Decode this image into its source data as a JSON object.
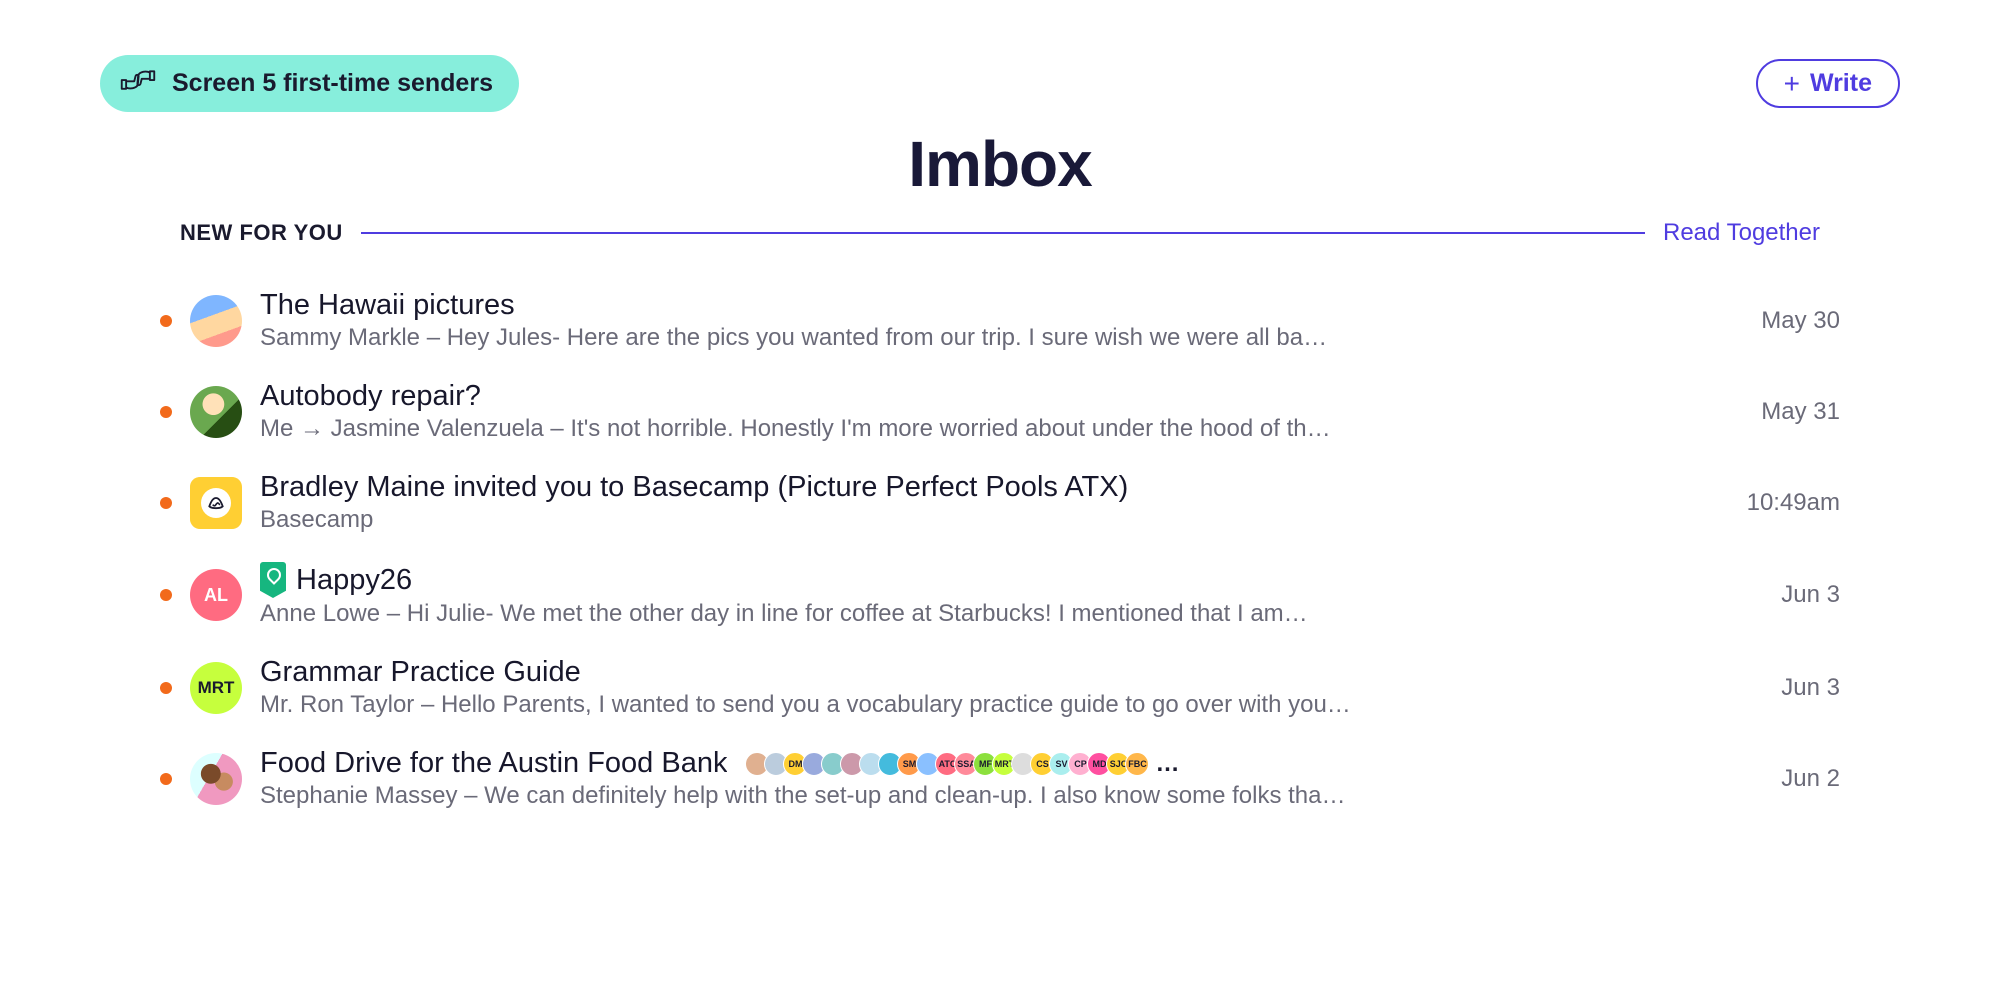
{
  "header": {
    "screener_label": "Screen 5 first-time senders",
    "write_label": "Write"
  },
  "page_title": "Imbox",
  "section": {
    "label": "NEW FOR YOU",
    "read_together": "Read Together"
  },
  "emails": [
    {
      "subject": "The Hawaii pictures",
      "preview": "Sammy Markle – Hey Jules- Here are the pics you wanted from our trip. I sure wish we were all ba…",
      "date": "May 30",
      "avatar_type": "photo1"
    },
    {
      "subject": "Autobody repair?",
      "preview": "Me → Jasmine Valenzuela – It's not horrible. Honestly I'm more worried about under the hood of th…",
      "date": "May 31",
      "avatar_type": "photo2"
    },
    {
      "subject": "Bradley Maine invited you to Basecamp (Picture Perfect Pools ATX)",
      "preview": "Basecamp",
      "date": "10:49am",
      "avatar_type": "basecamp"
    },
    {
      "subject": "Happy26",
      "preview": "Anne Lowe – Hi Julie- We met the other day in line for coffee at Starbucks! I mentioned that I am…",
      "date": "Jun 3",
      "avatar_type": "initials",
      "avatar_initials": "AL",
      "has_clip": true
    },
    {
      "subject": "Grammar Practice Guide",
      "preview": "Mr. Ron Taylor – Hello Parents, I wanted to send you a vocabulary practice guide to go over with you…",
      "date": "Jun 3",
      "avatar_type": "initials",
      "avatar_initials": "MRT"
    },
    {
      "subject": "Food Drive for the Austin Food Bank",
      "preview": "Stephanie Massey – We can definitely help with the set-up and clean-up. I also know some folks tha…",
      "date": "Jun 2",
      "avatar_type": "photo3",
      "participants": [
        "",
        "",
        "DM",
        "",
        "",
        "",
        "",
        "",
        "SM",
        "",
        "ATC",
        "SSA",
        "MF",
        "MRT",
        "",
        "CS",
        "SV",
        "CP",
        "MD",
        "SJC",
        "FBC"
      ],
      "participant_colors": [
        "#e0b090",
        "#bcd",
        "#ffcf33",
        "#9ad",
        "#8cc",
        "#c9a",
        "#bde",
        "#4bd",
        "#ff9a4a",
        "#8ac0ff",
        "#ff6b81",
        "#ff8a9a",
        "#8ce03d",
        "#c6ff3d",
        "#ddd",
        "#ffcf33",
        "#aee",
        "#ffb0d0",
        "#ff4fa0",
        "#ffcf33",
        "#ffb74a"
      ]
    }
  ]
}
